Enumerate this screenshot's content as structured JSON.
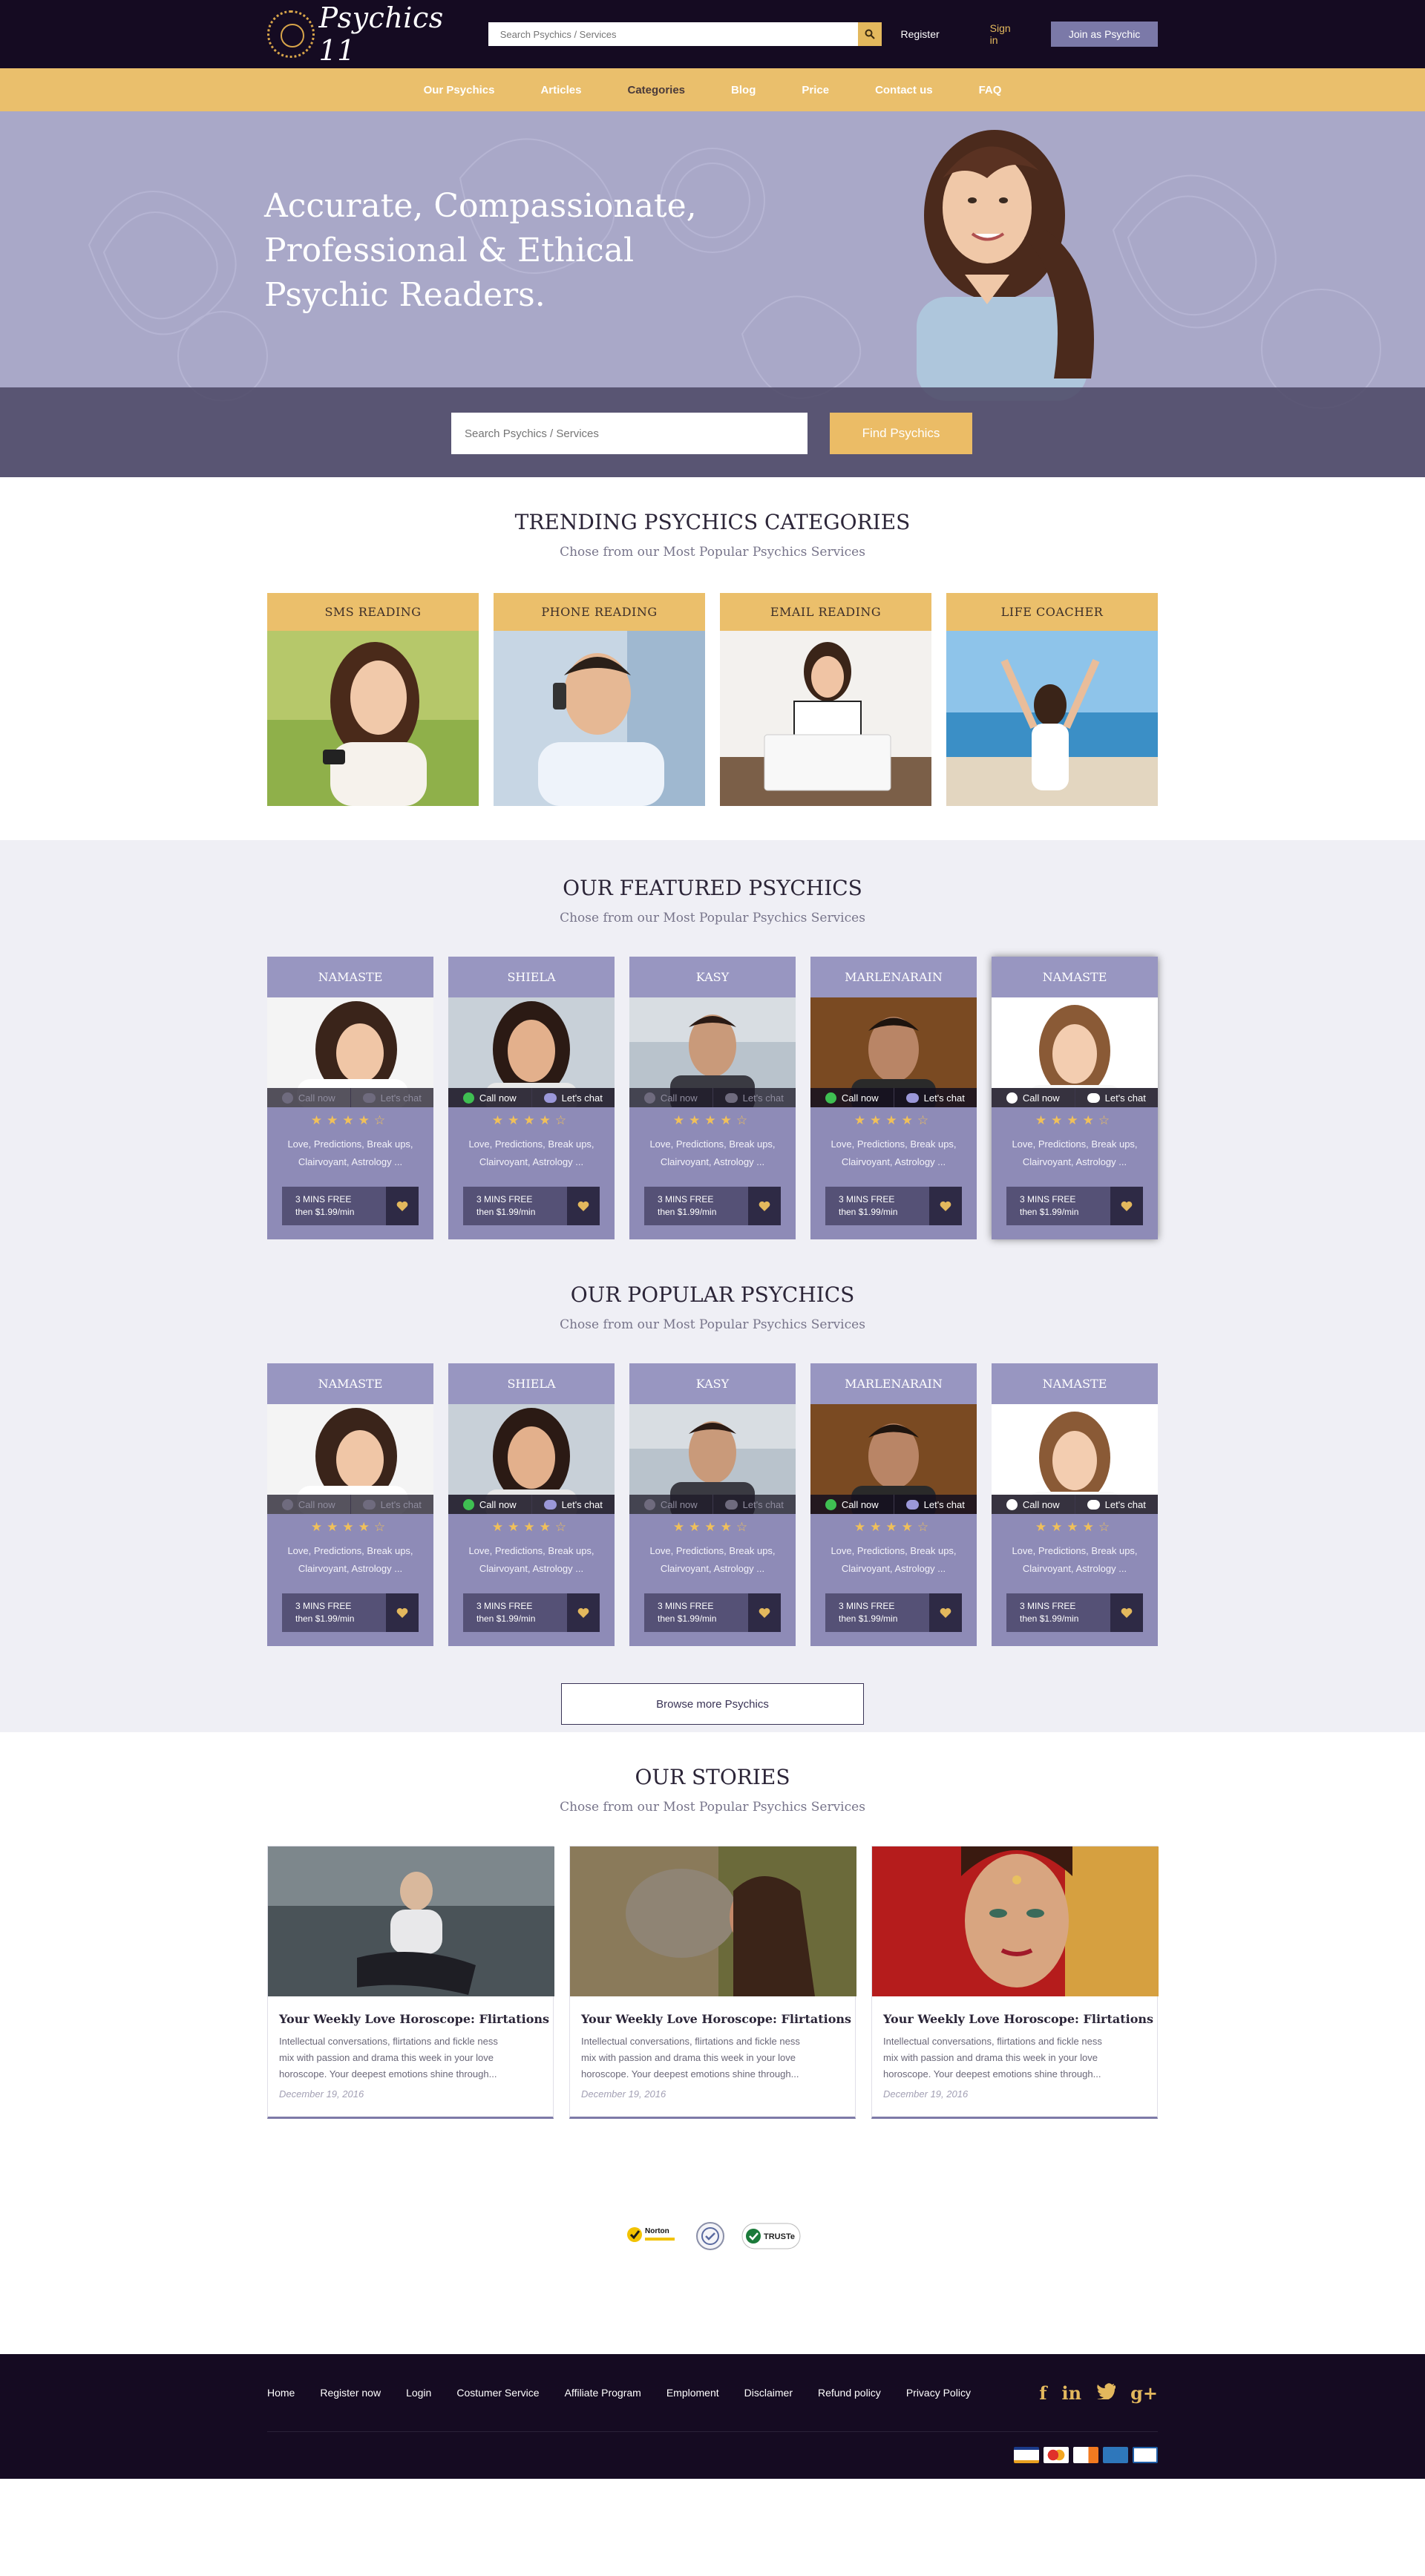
{
  "header": {
    "logo_text": "Psychics 11",
    "search_placeholder": "Search Psychics / Services",
    "register_label": "Register",
    "signin_label": "Sign in",
    "join_label": "Join as Psychic"
  },
  "nav": {
    "items": [
      "Our Psychics",
      "Articles",
      "Categories",
      "Blog",
      "Price",
      "Contact us",
      "FAQ"
    ],
    "active": "Categories"
  },
  "hero": {
    "headline_1": "Accurate, Compassionate,",
    "headline_2": "Professional & Ethical",
    "headline_3": "Psychic Readers.",
    "search_placeholder": "Search Psychics / Services",
    "find_label": "Find Psychics"
  },
  "trending": {
    "title": "TRENDING PSYCHICS CATEGORIES",
    "subtitle": "Chose from our Most Popular Psychics Services",
    "categories": [
      "SMS READING",
      "PHONE READING",
      "EMAIL READING",
      "LIFE COACHER"
    ]
  },
  "featured": {
    "title": "OUR FEATURED PSYCHICS",
    "subtitle": "Chose from our Most Popular Psychics Services",
    "cards": [
      {
        "name": "NAMASTE",
        "call": "Call now",
        "chat": "Let's chat",
        "rating": 4,
        "tags_1": "Love, Predictions, Break ups,",
        "tags_2": "Clairvoyant, Astrology ...",
        "price_1": "3 MINS FREE",
        "price_2": "then $1.99/min"
      },
      {
        "name": "SHIELA",
        "call": "Call now",
        "chat": "Let's chat",
        "rating": 4,
        "tags_1": "Love, Predictions, Break ups,",
        "tags_2": "Clairvoyant, Astrology ...",
        "price_1": "3 MINS FREE",
        "price_2": "then $1.99/min"
      },
      {
        "name": "KASY",
        "call": "Call now",
        "chat": "Let's chat",
        "rating": 4,
        "tags_1": "Love, Predictions, Break ups,",
        "tags_2": "Clairvoyant, Astrology ...",
        "price_1": "3 MINS FREE",
        "price_2": "then $1.99/min"
      },
      {
        "name": "MARLENARAIN",
        "call": "Call now",
        "chat": "Let's chat",
        "rating": 4,
        "tags_1": "Love, Predictions, Break ups,",
        "tags_2": "Clairvoyant, Astrology ...",
        "price_1": "3 MINS FREE",
        "price_2": "then $1.99/min"
      },
      {
        "name": "NAMASTE",
        "call": "Call now",
        "chat": "Let's chat",
        "rating": 4,
        "tags_1": "Love, Predictions, Break ups,",
        "tags_2": "Clairvoyant, Astrology ...",
        "price_1": "3 MINS FREE",
        "price_2": "then $1.99/min"
      }
    ]
  },
  "popular": {
    "title": "OUR POPULAR PSYCHICS",
    "subtitle": "Chose from our Most Popular Psychics Services",
    "cards": [
      {
        "name": "NAMASTE",
        "call": "Call now",
        "chat": "Let's chat",
        "rating": 4,
        "tags_1": "Love, Predictions, Break ups,",
        "tags_2": "Clairvoyant, Astrology ...",
        "price_1": "3 MINS FREE",
        "price_2": "then $1.99/min"
      },
      {
        "name": "SHIELA",
        "call": "Call now",
        "chat": "Let's chat",
        "rating": 4,
        "tags_1": "Love, Predictions, Break ups,",
        "tags_2": "Clairvoyant, Astrology ...",
        "price_1": "3 MINS FREE",
        "price_2": "then $1.99/min"
      },
      {
        "name": "KASY",
        "call": "Call now",
        "chat": "Let's chat",
        "rating": 4,
        "tags_1": "Love, Predictions, Break ups,",
        "tags_2": "Clairvoyant, Astrology ...",
        "price_1": "3 MINS FREE",
        "price_2": "then $1.99/min"
      },
      {
        "name": "MARLENARAIN",
        "call": "Call now",
        "chat": "Let's chat",
        "rating": 4,
        "tags_1": "Love, Predictions, Break ups,",
        "tags_2": "Clairvoyant, Astrology ...",
        "price_1": "3 MINS FREE",
        "price_2": "then $1.99/min"
      },
      {
        "name": "NAMASTE",
        "call": "Call now",
        "chat": "Let's chat",
        "rating": 4,
        "tags_1": "Love, Predictions, Break ups,",
        "tags_2": "Clairvoyant, Astrology ...",
        "price_1": "3 MINS FREE",
        "price_2": "then $1.99/min"
      }
    ],
    "browse_label": "Browse more Psychics"
  },
  "stories": {
    "title": "OUR STORIES",
    "subtitle": "Chose from our Most Popular Psychics Services",
    "items": [
      {
        "title": "Your Weekly Love Horoscope: Flirtations",
        "text_1": "Intellectual conversations, flirtations and fickle ness",
        "text_2": "mix with passion and drama this week in your love",
        "text_3": "horoscope. Your deepest emotions shine through...",
        "date": "December 19, 2016"
      },
      {
        "title": "Your Weekly Love Horoscope: Flirtations",
        "text_1": "Intellectual conversations, flirtations and fickle ness",
        "text_2": "mix with passion and drama this week in your love",
        "text_3": "horoscope. Your deepest emotions shine through...",
        "date": "December 19, 2016"
      },
      {
        "title": "Your Weekly Love Horoscope: Flirtations",
        "text_1": "Intellectual conversations, flirtations and fickle ness",
        "text_2": "mix with passion and drama this week in your love",
        "text_3": "horoscope. Your deepest emotions shine through...",
        "date": "December 19, 2016"
      }
    ]
  },
  "trust_badges": {
    "norton": "Norton",
    "truste": "TRUSTe"
  },
  "footer": {
    "links": [
      "Home",
      "Register now",
      "Login",
      "Costumer Service",
      "Affiliate Program",
      "Emploment",
      "Disclaimer",
      "Refund policy",
      "Privacy Policy"
    ],
    "social": [
      "f",
      "in",
      "t",
      "g+"
    ],
    "social_icons": [
      "facebook-icon",
      "linkedin-icon",
      "twitter-icon",
      "google-plus-icon"
    ],
    "cards": [
      "visa-card-icon",
      "mastercard-icon",
      "discover-card-icon",
      "amex-card-icon",
      "paypal-icon"
    ]
  },
  "colors": {
    "dark": "#150b22",
    "gold": "#eabf6c",
    "lavender": "#8e8bb7",
    "lavender_light": "#9896c1"
  }
}
